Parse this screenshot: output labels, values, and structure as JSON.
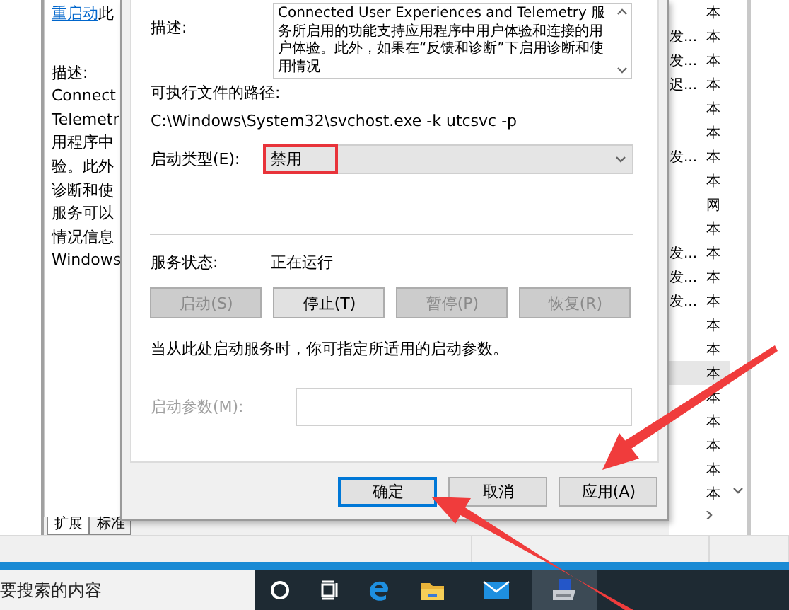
{
  "main_window": {
    "details": {
      "link": "重启动",
      "link_rest": "此",
      "description_label": "描述:",
      "description_lines": [
        "Connect",
        "Telemetr",
        "用程序中",
        "验。此外",
        "诊断和使",
        "服务可以",
        "情况信息",
        "Windows"
      ]
    },
    "list_rows": [
      {
        "column_1": "",
        "column_2": "本",
        "selected": false
      },
      {
        "column_1": "发...",
        "column_2": "本",
        "selected": false
      },
      {
        "column_1": "发...",
        "column_2": "本",
        "selected": false
      },
      {
        "column_1": "迟...",
        "column_2": "本",
        "selected": false
      },
      {
        "column_1": "",
        "column_2": "本",
        "selected": false
      },
      {
        "column_1": "",
        "column_2": "本",
        "selected": false
      },
      {
        "column_1": "发...",
        "column_2": "本",
        "selected": false
      },
      {
        "column_1": "",
        "column_2": "本",
        "selected": false
      },
      {
        "column_1": "",
        "column_2": "网",
        "selected": false
      },
      {
        "column_1": "",
        "column_2": "本",
        "selected": false
      },
      {
        "column_1": "发...",
        "column_2": "本",
        "selected": false
      },
      {
        "column_1": "发...",
        "column_2": "本",
        "selected": false
      },
      {
        "column_1": "发...",
        "column_2": "本",
        "selected": false
      },
      {
        "column_1": "",
        "column_2": "本",
        "selected": false
      },
      {
        "column_1": "",
        "column_2": "本",
        "selected": false
      },
      {
        "column_1": "",
        "column_2": "本",
        "selected": true
      },
      {
        "column_1": "",
        "column_2": "本",
        "selected": false
      },
      {
        "column_1": "",
        "column_2": "本",
        "selected": false
      },
      {
        "column_1": "",
        "column_2": "本",
        "selected": false
      },
      {
        "column_1": "",
        "column_2": "本",
        "selected": false
      },
      {
        "column_1": "",
        "column_2": "本",
        "selected": false
      }
    ],
    "tabs": [
      {
        "label": "扩展",
        "selected": true
      },
      {
        "label": "标准",
        "selected": false
      }
    ]
  },
  "dialog": {
    "description_label": "描述:",
    "description_text": "Connected User Experiences and Telemetry 服务所启用的功能支持应用程序中用户体验和连接的用户体验。此外，如果在“反馈和诊断”下启用诊断和使用情况",
    "path_label": "可执行文件的路径:",
    "path": "C:\\Windows\\System32\\svchost.exe -k utcsvc -p",
    "startup_type_label": "启动类型(E):",
    "startup_type": "禁用",
    "startup_type_highlighted": true,
    "status_label": "服务状态:",
    "status": "正在运行",
    "service_buttons": [
      {
        "label": "启动(S)",
        "disabled": true
      },
      {
        "label": "停止(T)",
        "disabled": false
      },
      {
        "label": "暂停(P)",
        "disabled": true
      },
      {
        "label": "恢复(R)",
        "disabled": true
      }
    ],
    "hint": "当从此处启动服务时，你可指定所适用的启动参数。",
    "start_params_label": "启动参数(M):",
    "start_params_disabled": true,
    "buttons": [
      {
        "label": "确定",
        "default": true
      },
      {
        "label": "取消",
        "default": false
      },
      {
        "label": "应用(A)",
        "default": false
      }
    ]
  },
  "taskbar": {
    "search_text": "要搜索的内容",
    "apps": [
      {
        "kind": "cortana",
        "active": false
      },
      {
        "kind": "taskview",
        "active": false
      },
      {
        "kind": "browser",
        "active": false
      },
      {
        "kind": "folder",
        "active": false
      },
      {
        "kind": "mail",
        "active": false
      },
      {
        "kind": "printer",
        "active": true
      }
    ]
  }
}
